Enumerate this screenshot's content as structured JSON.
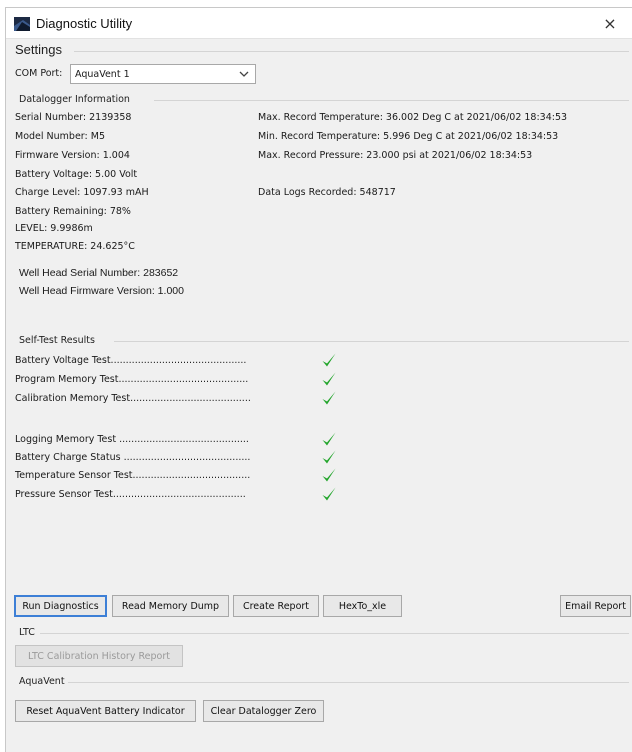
{
  "window": {
    "title": "Diagnostic Utility",
    "close_glyph": "×"
  },
  "settings": {
    "title": "Settings",
    "com_port_label": "COM Port:",
    "com_port_value": "AquaVent 1"
  },
  "datalogger": {
    "title": "Datalogger Information",
    "left": [
      "Serial Number: 2139358",
      "Model Number: M5",
      "Firmware Version: 1.004",
      "Battery Voltage: 5.00 Volt",
      "Charge Level: 1097.93 mAH",
      "Battery Remaining: 78%",
      "LEVEL: 9.9986m",
      "TEMPERATURE: 24.625°C"
    ],
    "right": [
      "Max. Record Temperature: 36.002 Deg C at 2021/06/02 18:34:53",
      "Min. Record Temperature: 5.996 Deg C at 2021/06/02 18:34:53",
      "Max. Record Pressure: 23.000 psi at 2021/06/02 18:34:53"
    ],
    "data_logs": "Data Logs Recorded: 548717",
    "well_head_serial": "Well Head Serial Number: 283652",
    "well_head_firmware": "Well Head Firmware Version: 1.000"
  },
  "self_test": {
    "title": "Self-Test Results",
    "tests": [
      "Battery Voltage Test.............................................",
      "Program Memory Test...........................................",
      "Calibration Memory Test........................................",
      "Logging Memory Test ...........................................",
      "Battery Charge Status ..........................................",
      "Temperature Sensor Test.......................................",
      "Pressure Sensor Test............................................"
    ],
    "pass_color": "#22a52b"
  },
  "buttons": {
    "run_diagnostics": "Run Diagnostics",
    "read_memory_dump": "Read Memory Dump",
    "create_report": "Create Report",
    "hex_to_xle": "HexTo_xle",
    "email_report": "Email Report"
  },
  "ltc": {
    "title": "LTC",
    "calibration_history": "LTC Calibration History Report"
  },
  "aquavent": {
    "title": "AquaVent",
    "reset_battery": "Reset AquaVent Battery Indicator",
    "clear_zero": "Clear Datalogger Zero"
  },
  "icons": {
    "app": "app-logo-icon",
    "close": "close-icon",
    "dropdown": "chevron-down-icon",
    "check": "checkmark-icon"
  },
  "accent_color": "#3d7fd6"
}
